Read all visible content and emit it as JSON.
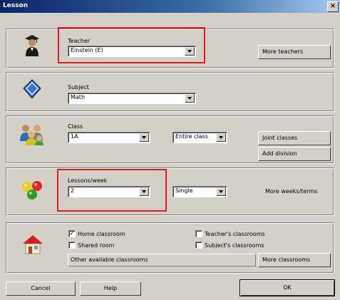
{
  "window": {
    "title": "Lesson",
    "close_glyph": "×"
  },
  "teacher": {
    "label": "Teacher",
    "value": "Einstein (E)",
    "more_button": "More teachers"
  },
  "subject": {
    "label": "Subject",
    "value": "Math"
  },
  "class": {
    "label": "Class",
    "value": "1A",
    "scope": "Entire class",
    "joint_button": "Joint classes",
    "division_button": "Add division"
  },
  "lessons": {
    "label": "Lessons/week",
    "value": "2",
    "mode": "Single",
    "more_weeks": "More weeks/terms"
  },
  "rooms": {
    "home_classroom": {
      "label": "Home classroom",
      "checked": "✓"
    },
    "shared_room": {
      "label": "Shared room",
      "checked": ""
    },
    "teachers_classrooms": {
      "label": "Teacher's classrooms",
      "checked": ""
    },
    "subjects_classrooms": {
      "label": "Subject's classrooms",
      "checked": ""
    },
    "other_available": "Other available classrooms",
    "more_button": "More classrooms"
  },
  "footer": {
    "cancel": "Cancel",
    "help": "Help",
    "ok": "OK"
  },
  "highlight_color": "#e02020"
}
